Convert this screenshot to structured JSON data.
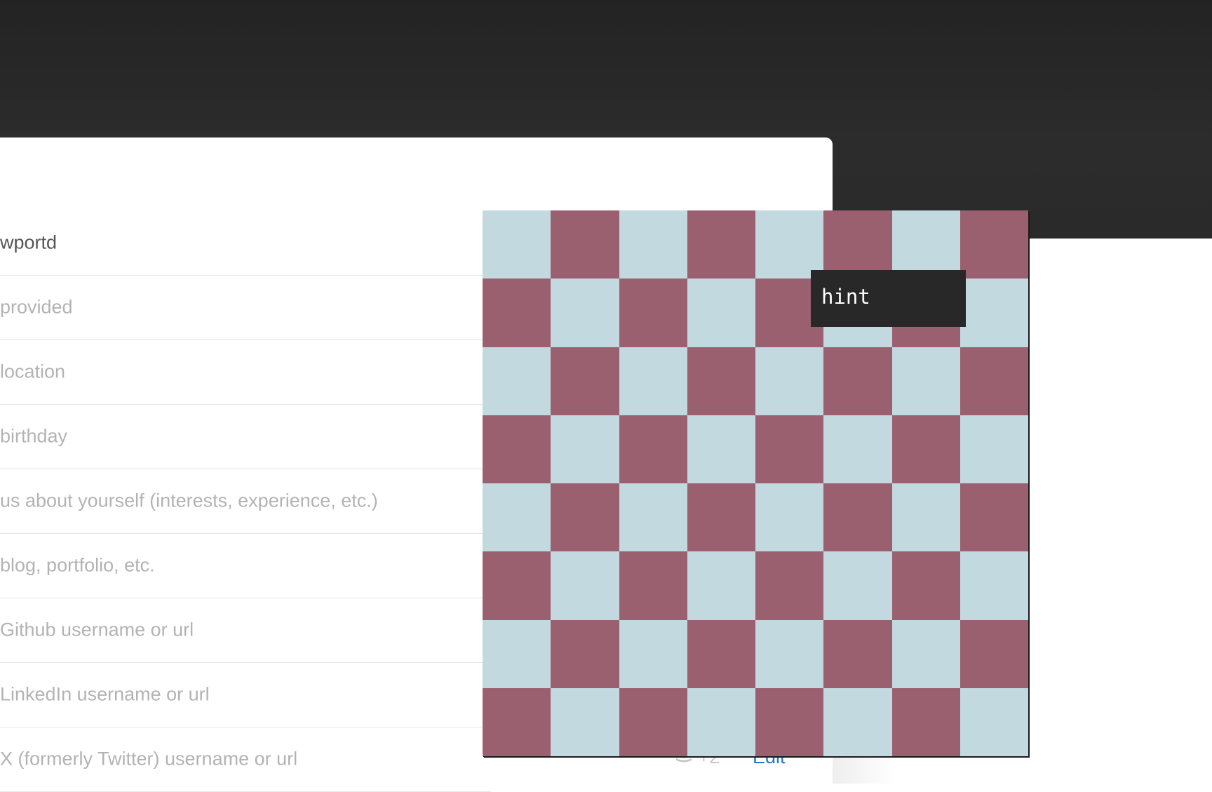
{
  "form": {
    "rows": [
      {
        "text": "wportd",
        "filled": true
      },
      {
        "text": "provided",
        "filled": false
      },
      {
        "text": " location",
        "filled": false
      },
      {
        "text": " birthday",
        "filled": false
      },
      {
        "text": "us about yourself (interests, experience, etc.)",
        "filled": false
      },
      {
        "text": " blog, portfolio, etc.",
        "filled": false
      },
      {
        "text": " Github username or url",
        "filled": false
      },
      {
        "text": " LinkedIn username or url",
        "filled": false
      },
      {
        "text": " X (formerly Twitter) username or url",
        "filled": false
      }
    ]
  },
  "footer": {
    "count": "+2",
    "count_icon": "coin-stack-icon",
    "edit_label": "Edit"
  },
  "board": {
    "size": 8,
    "light_color": "#c2d9df",
    "dark_color": "#9a6070",
    "first_square": "light"
  },
  "tooltip": {
    "text": "hint"
  },
  "colors": {
    "top_bar": "#2a2a2a",
    "tooltip_bg": "#282828",
    "link": "#2a75c8"
  }
}
